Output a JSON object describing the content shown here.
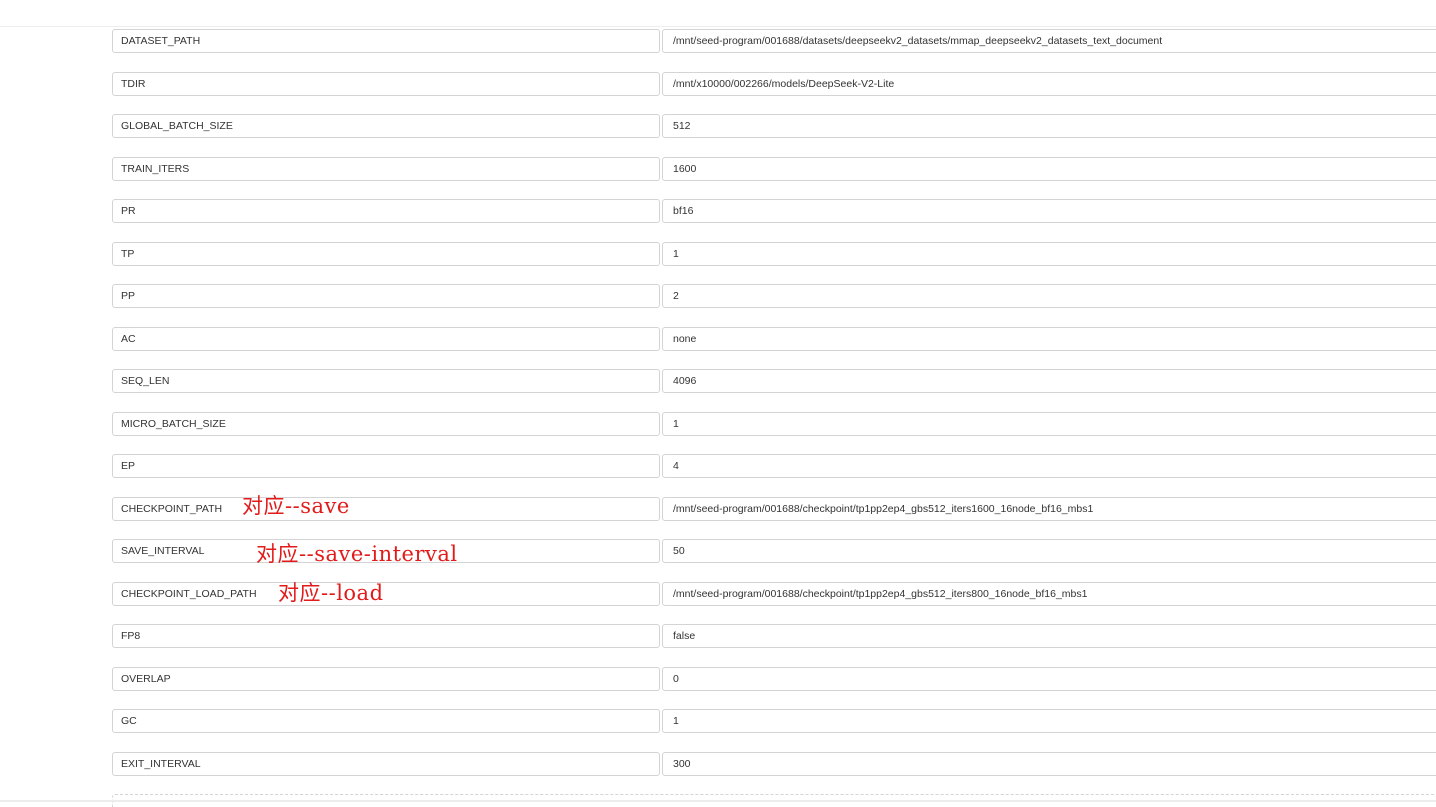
{
  "params": [
    {
      "key": "DATASET_PATH",
      "value": "/mnt/seed-program/001688/datasets/deepseekv2_datasets/mmap_deepseekv2_datasets_text_document",
      "annotation": ""
    },
    {
      "key": "TDIR",
      "value": "/mnt/x10000/002266/models/DeepSeek-V2-Lite",
      "annotation": ""
    },
    {
      "key": "GLOBAL_BATCH_SIZE",
      "value": "512",
      "annotation": ""
    },
    {
      "key": "TRAIN_ITERS",
      "value": "1600",
      "annotation": ""
    },
    {
      "key": "PR",
      "value": "bf16",
      "annotation": ""
    },
    {
      "key": "TP",
      "value": "1",
      "annotation": ""
    },
    {
      "key": "PP",
      "value": "2",
      "annotation": ""
    },
    {
      "key": "AC",
      "value": "none",
      "annotation": ""
    },
    {
      "key": "SEQ_LEN",
      "value": "4096",
      "annotation": ""
    },
    {
      "key": "MICRO_BATCH_SIZE",
      "value": "1",
      "annotation": ""
    },
    {
      "key": "EP",
      "value": "4",
      "annotation": ""
    },
    {
      "key": "CHECKPOINT_PATH",
      "value": "/mnt/seed-program/001688/checkpoint/tp1pp2ep4_gbs512_iters1600_16node_bf16_mbs1",
      "annotation": "对应--save"
    },
    {
      "key": "SAVE_INTERVAL",
      "value": "50",
      "annotation": "对应--save-interval"
    },
    {
      "key": "CHECKPOINT_LOAD_PATH",
      "value": "/mnt/seed-program/001688/checkpoint/tp1pp2ep4_gbs512_iters800_16node_bf16_mbs1",
      "annotation": "对应--load"
    },
    {
      "key": "FP8",
      "value": "false",
      "annotation": ""
    },
    {
      "key": "OVERLAP",
      "value": "0",
      "annotation": ""
    },
    {
      "key": "GC",
      "value": "1",
      "annotation": ""
    },
    {
      "key": "EXIT_INTERVAL",
      "value": "300",
      "annotation": ""
    }
  ],
  "colors": {
    "annotation": "#e21a1a",
    "border": "#d4d4d4",
    "text": "#333333"
  }
}
